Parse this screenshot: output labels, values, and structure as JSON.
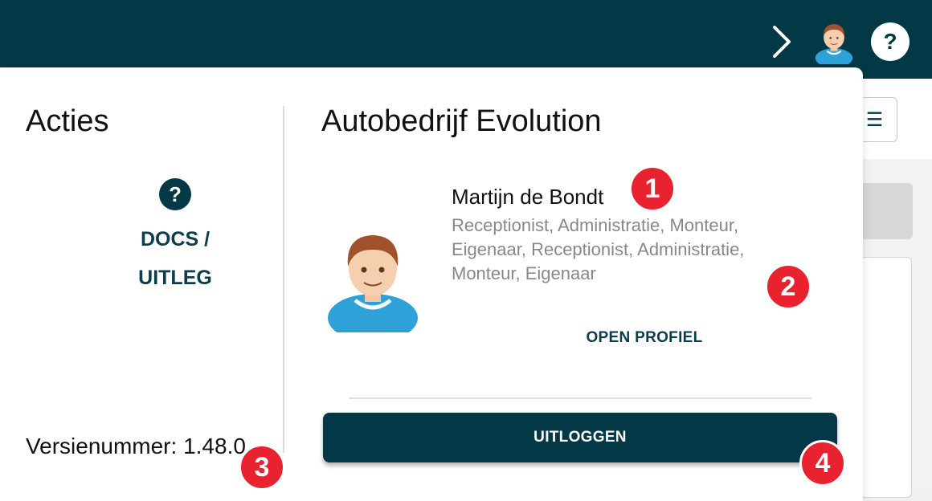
{
  "header": {
    "icons": [
      "chevron-right-icon",
      "user-avatar-icon",
      "help-icon"
    ],
    "help_label": "?"
  },
  "actions": {
    "title": "Acties",
    "docs_icon": "?",
    "docs_line1": "DOCS /",
    "docs_line2": "UITLEG",
    "version": "Versienummer: 1.48.0"
  },
  "profile": {
    "company": "Autobedrijf Evolution",
    "name": "Martijn de Bondt",
    "roles": "Receptionist, Administratie, Monteur, Eigenaar, Receptionist, Administratie, Monteur, Eigenaar",
    "open_profile": "OPEN PROFIEL",
    "logout": "UITLOGGEN"
  },
  "markers": [
    "1",
    "2",
    "3",
    "4"
  ],
  "colors": {
    "primary": "#033846",
    "marker": "#e8232f"
  }
}
